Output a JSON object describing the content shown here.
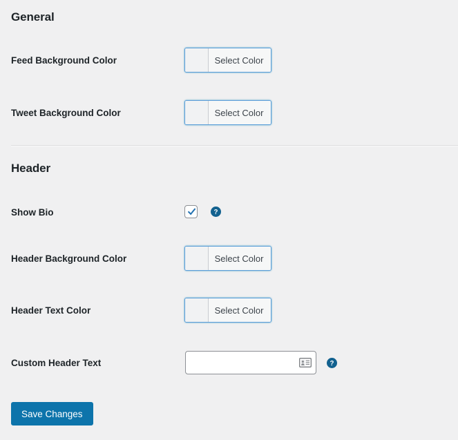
{
  "page": {
    "background_color": "#f0f0f1",
    "accent_color": "#0d74ab",
    "picker_border_color": "#5b9dd9",
    "label_color": "#1d2327"
  },
  "sections": [
    {
      "heading": "General",
      "fields": [
        {
          "label": "Feed Background Color",
          "control": "color-picker",
          "button_text": "Select Color"
        },
        {
          "label": "Tweet Background Color",
          "control": "color-picker",
          "button_text": "Select Color"
        }
      ]
    },
    {
      "heading": "Header",
      "fields": [
        {
          "label": "Show Bio",
          "control": "checkbox",
          "checked": true,
          "help": "help-icon"
        },
        {
          "label": "Header Background Color",
          "control": "color-picker",
          "button_text": "Select Color"
        },
        {
          "label": "Header Text Color",
          "control": "color-picker",
          "button_text": "Select Color"
        },
        {
          "label": "Custom Header Text",
          "control": "text-input",
          "value": "",
          "placeholder": "",
          "help": "help-icon",
          "field_icon": "contact-card-icon"
        }
      ]
    }
  ],
  "footer": {
    "save_label": "Save Changes"
  },
  "icons": {
    "help": "help-circle-icon",
    "checkmark": "check-icon",
    "autofill": "contact-card-icon"
  }
}
